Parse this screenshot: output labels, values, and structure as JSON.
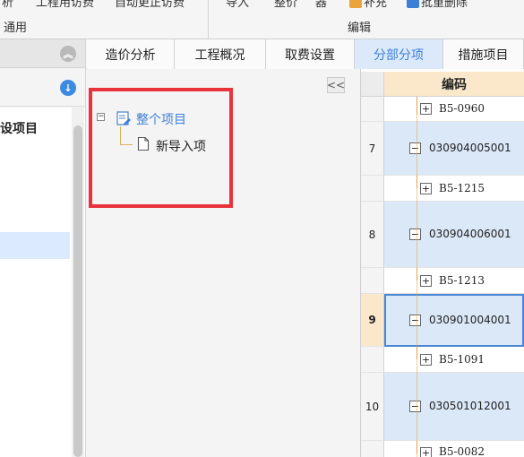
{
  "ribbon": {
    "top_items": [
      "析",
      "工程用访费",
      "自动更正访费",
      "导入",
      "整价",
      "器",
      "补充",
      "批重删除"
    ],
    "groups": [
      "通用",
      "编辑"
    ]
  },
  "left_panel": {
    "item_text": "设项目"
  },
  "tabs": [
    {
      "label": "造价分析",
      "active": false
    },
    {
      "label": "工程概况",
      "active": false
    },
    {
      "label": "取费设置",
      "active": false
    },
    {
      "label": "分部分项",
      "active": true
    },
    {
      "label": "措施项目",
      "active": false
    }
  ],
  "tree": {
    "collapse_symbol": "<<",
    "root_toggle": "⊟",
    "root_label": "整个项目",
    "child_label": "新导入项"
  },
  "grid": {
    "column_header": "编码",
    "rows": [
      {
        "num": "",
        "code": "B5-0960",
        "kind": "child"
      },
      {
        "num": "7",
        "code": "030904005001",
        "kind": "parent"
      },
      {
        "num": "",
        "code": "B5-1215",
        "kind": "child"
      },
      {
        "num": "8",
        "code": "030904006001",
        "kind": "parent"
      },
      {
        "num": "",
        "code": "B5-1213",
        "kind": "child"
      },
      {
        "num": "9",
        "code": "030901004001",
        "kind": "parent",
        "selected": true
      },
      {
        "num": "",
        "code": "B5-1091",
        "kind": "child"
      },
      {
        "num": "10",
        "code": "030501012001",
        "kind": "parent"
      },
      {
        "num": "",
        "code": "B5-0082",
        "kind": "child"
      }
    ]
  },
  "colors": {
    "accent": "#3d7fd8",
    "highlight_box": "#e8333a",
    "header_orange": "#fbe7c9",
    "parent_row": "#dbe8f8"
  }
}
